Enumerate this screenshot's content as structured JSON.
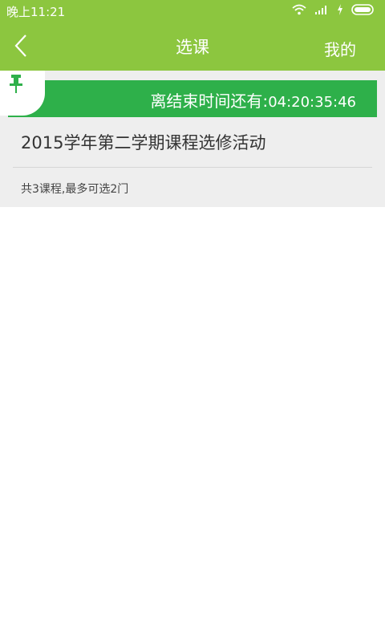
{
  "status": {
    "time": "晚上11:21"
  },
  "header": {
    "title": "选课",
    "right_label": "我的"
  },
  "banner": {
    "label": "离结束时间还有:",
    "countdown": "04:20:35:46"
  },
  "activity": {
    "title": "2015学年第二学期课程选修活动",
    "summary": "共3课程,最多可选2门"
  },
  "colors": {
    "header_green": "#8cc63f",
    "banner_green": "#2eb04a",
    "card_bg": "#eeeeee"
  }
}
